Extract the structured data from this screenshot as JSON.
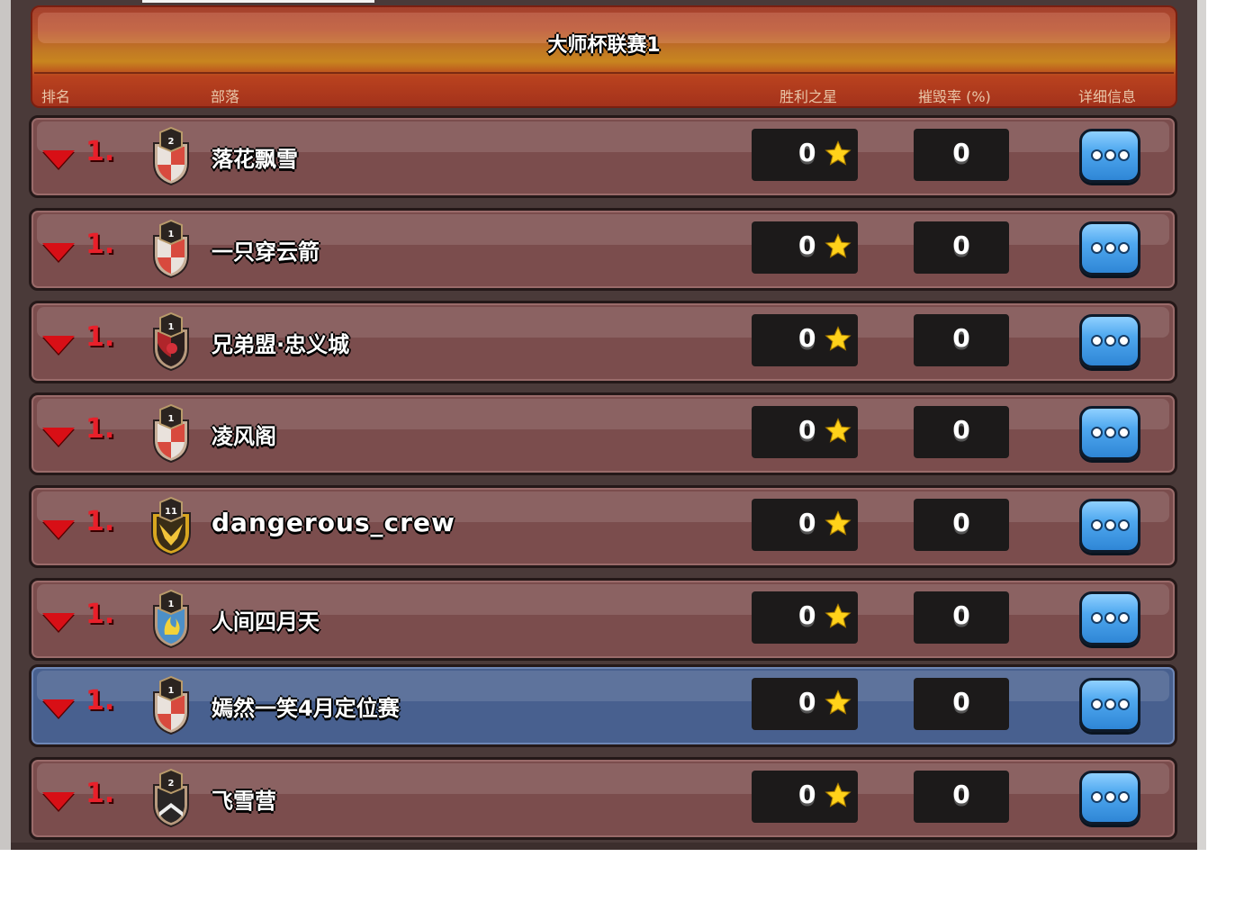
{
  "header": {
    "title": "大师杯联赛1",
    "columns": {
      "rank": "排名",
      "clan": "部落",
      "stars": "胜利之星",
      "destruction": "摧毁率 (%)",
      "details": "详细信息"
    }
  },
  "rows": [
    {
      "rank": "1.",
      "name": "落花飘雪",
      "badge_level": "2",
      "badge_style": "red-white-checker",
      "stars": "0",
      "destruction": "0"
    },
    {
      "rank": "1.",
      "name": "一只穿云箭",
      "badge_level": "1",
      "badge_style": "red-white-checker",
      "stars": "0",
      "destruction": "0"
    },
    {
      "rank": "1.",
      "name": "兄弟盟·忠义城",
      "badge_level": "1",
      "badge_style": "black-red",
      "stars": "0",
      "destruction": "0"
    },
    {
      "rank": "1.",
      "name": "凌风阁",
      "badge_level": "1",
      "badge_style": "red-white-checker",
      "stars": "0",
      "destruction": "0"
    },
    {
      "rank": "1.",
      "name": "dangerous_crew",
      "badge_level": "11",
      "badge_style": "gold-wings",
      "stars": "0",
      "destruction": "0"
    },
    {
      "rank": "1.",
      "name": "人间四月天",
      "badge_level": "1",
      "badge_style": "blue-flame",
      "stars": "0",
      "destruction": "0"
    },
    {
      "rank": "1.",
      "name": "嫣然一笑4月定位赛",
      "badge_level": "1",
      "badge_style": "red-white-checker",
      "stars": "0",
      "destruction": "0",
      "highlighted": true
    },
    {
      "rank": "1.",
      "name": "飞雪营",
      "badge_level": "2",
      "badge_style": "black-chevron",
      "stars": "0",
      "destruction": "0"
    }
  ],
  "icons": {
    "rank_change": "down-arrow-icon",
    "stars": "star-icon",
    "details": "more-dots-icon"
  },
  "colors": {
    "row_bg": "#7b4d4d",
    "row_highlight_bg": "#48608f",
    "header_accent": "#c8851f",
    "rank_red": "#e8202a",
    "button_blue": "#4fa8ef",
    "star_gold": "#ffd21a"
  }
}
